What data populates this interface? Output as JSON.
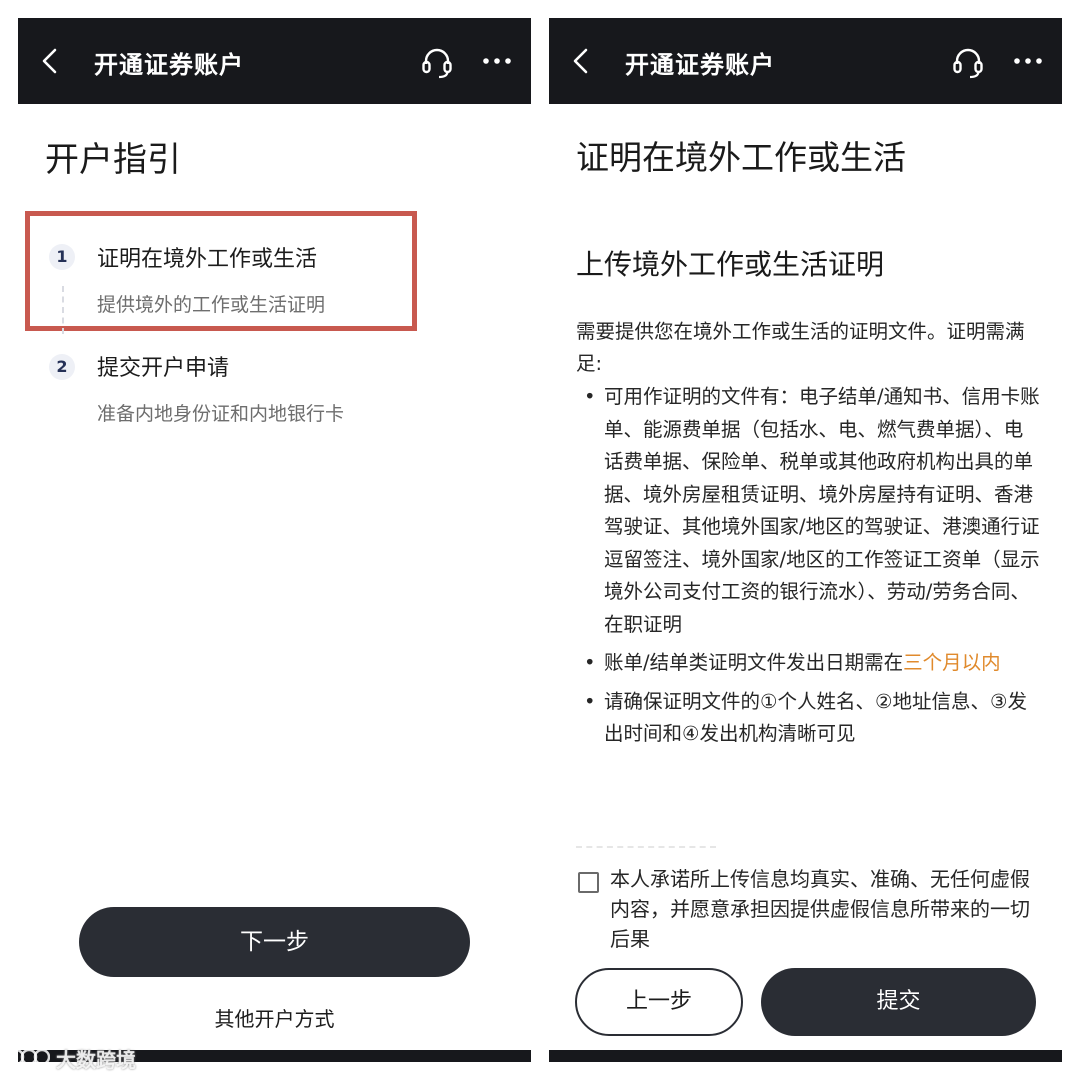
{
  "left": {
    "nav_title": "开通证券账户",
    "page_title": "开户指引",
    "steps": [
      {
        "num": "1",
        "title": "证明在境外工作或生活",
        "subtitle": "提供境外的工作或生活证明"
      },
      {
        "num": "2",
        "title": "提交开户申请",
        "subtitle": "准备内地身份证和内地银行卡"
      }
    ],
    "next_button": "下一步",
    "other_methods": "其他开户方式"
  },
  "right": {
    "nav_title": "开通证券账户",
    "page_title": "证明在境外工作或生活",
    "section_title": "上传境外工作或生活证明",
    "description": "需要提供您在境外工作或生活的证明文件。证明需满足:",
    "bullets": [
      {
        "text": "可用作证明的文件有：电子结单/通知书、信用卡账单、能源费单据（包括水、电、燃气费单据）、电话费单据、保险单、税单或其他政府机构出具的单据、境外房屋租赁证明、境外房屋持有证明、香港驾驶证、其他境外国家/地区的驾驶证、港澳通行证逗留签注、境外国家/地区的工作签证工资单（显示境外公司支付工资的银行流水）、劳动/劳务合同、在职证明"
      },
      {
        "text": "账单/结单类证明文件发出日期需在",
        "highlight": "三个月以内"
      },
      {
        "text": "请确保证明文件的①个人姓名、②地址信息、③发出时间和④发出机构清晰可见"
      }
    ],
    "bullet_symbol": "•",
    "agreement": "本人承诺所上传信息均真实、准确、无任何虚假内容，并愿意承担因提供虚假信息所带来的一切后果",
    "prev_button": "上一步",
    "submit_button": "提交"
  },
  "watermark": {
    "text": "大数跨境"
  },
  "colors": {
    "navbar": "#17181c",
    "button_dark": "#2a2d34",
    "highlight_orange": "#e08a2c",
    "step_box_border": "#c8594f"
  },
  "icons": {
    "back": "chevron-left-icon",
    "service": "headset-icon",
    "more": "more-dots-icon"
  }
}
